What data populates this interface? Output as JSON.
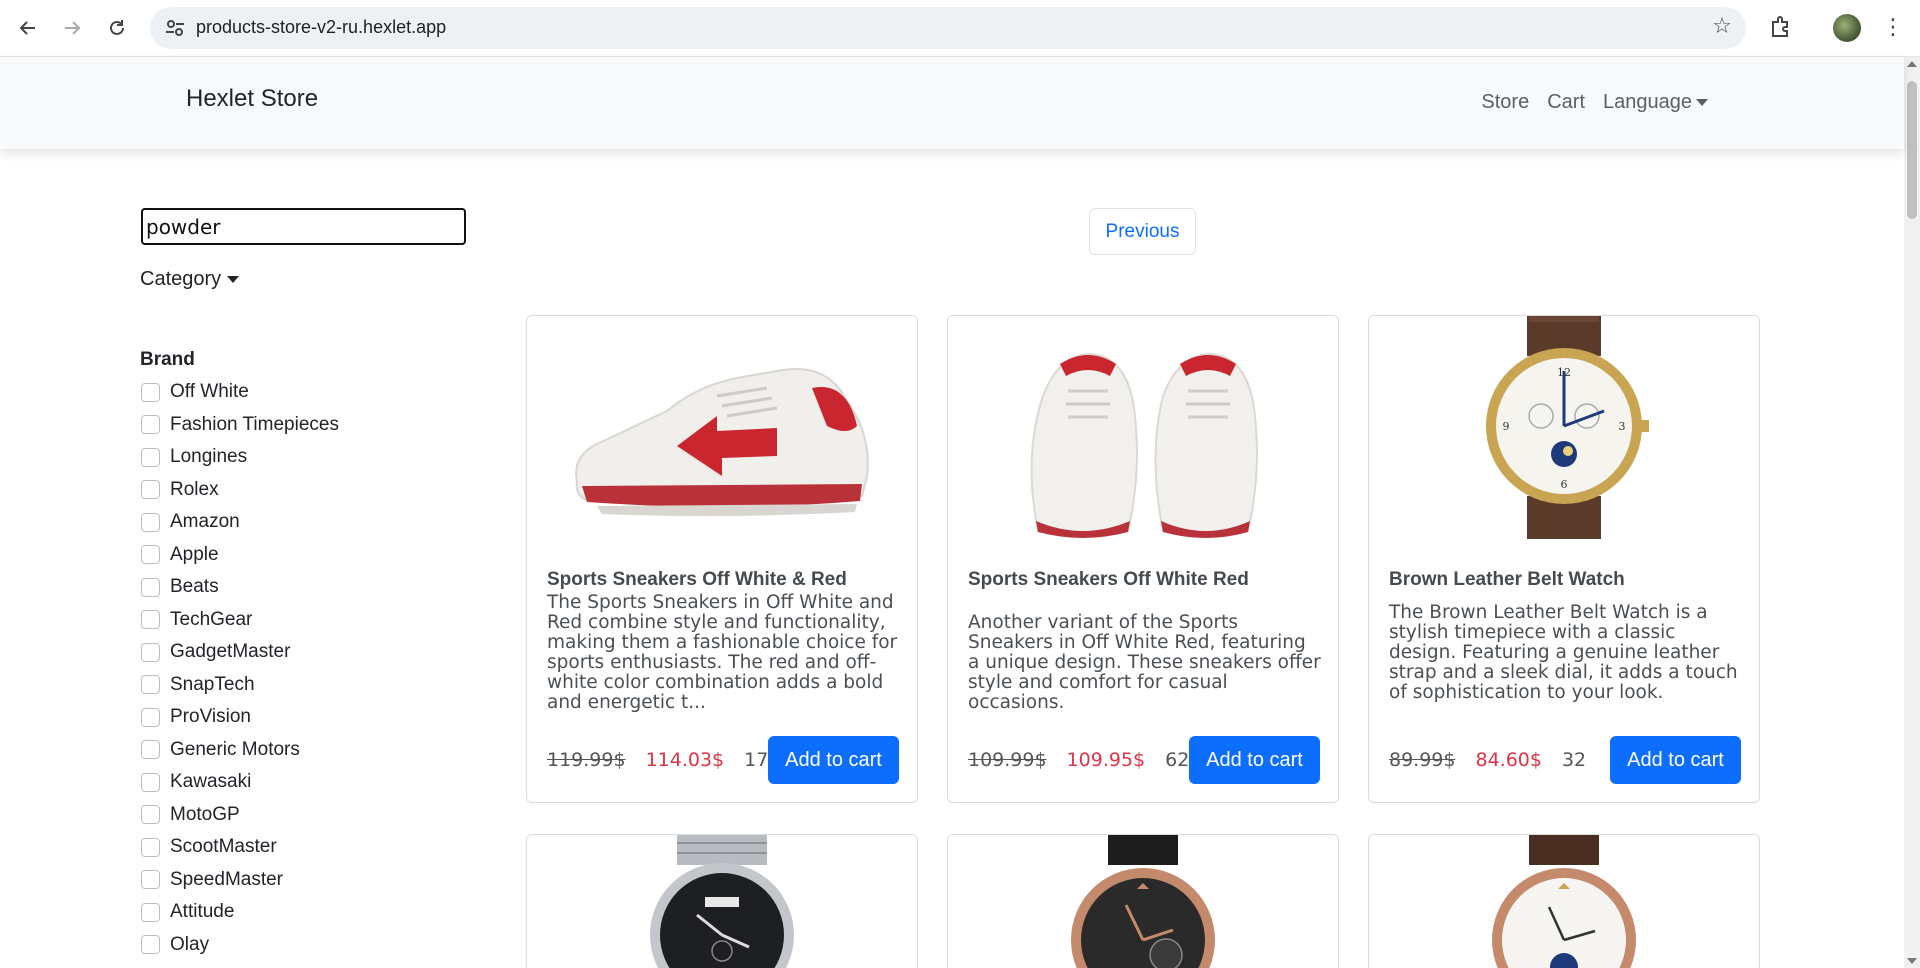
{
  "browser": {
    "url": "products-store-v2-ru.hexlet.app"
  },
  "navbar": {
    "brand": "Hexlet Store",
    "links": [
      "Store",
      "Cart",
      "Language"
    ]
  },
  "sidebar": {
    "search_value": "powder",
    "category_label": "Category",
    "brand_heading": "Brand",
    "brands": [
      "Off White",
      "Fashion Timepieces",
      "Longines",
      "Rolex",
      "Amazon",
      "Apple",
      "Beats",
      "TechGear",
      "GadgetMaster",
      "SnapTech",
      "ProVision",
      "Generic Motors",
      "Kawasaki",
      "MotoGP",
      "ScootMaster",
      "SpeedMaster",
      "Attitude",
      "Olay"
    ]
  },
  "pagination": {
    "previous_label": "Previous"
  },
  "products": [
    {
      "title": "Sports Sneakers Off White & Red",
      "description": "The Sports Sneakers in Off White and Red combine style and functionality, making them a fashionable choice for sports enthusiasts. The red and off-white color combination adds a bold and energetic t...",
      "old_price": "119.99$",
      "new_price": "114.03$",
      "stock": "17",
      "button": "Add to cart"
    },
    {
      "title": "Sports Sneakers Off White Red",
      "description": "Another variant of the Sports Sneakers in Off White Red, featuring a unique design. These sneakers offer style and comfort for casual occasions.",
      "old_price": "109.99$",
      "new_price": "109.95$",
      "stock": "62",
      "button": "Add to cart"
    },
    {
      "title": "Brown Leather Belt Watch",
      "description": "The Brown Leather Belt Watch is a stylish timepiece with a classic design. Featuring a genuine leather strap and a sleek dial, it adds a touch of sophistication to your look.",
      "old_price": "89.99$",
      "new_price": "84.60$",
      "stock": "32",
      "button": "Add to cart"
    }
  ]
}
